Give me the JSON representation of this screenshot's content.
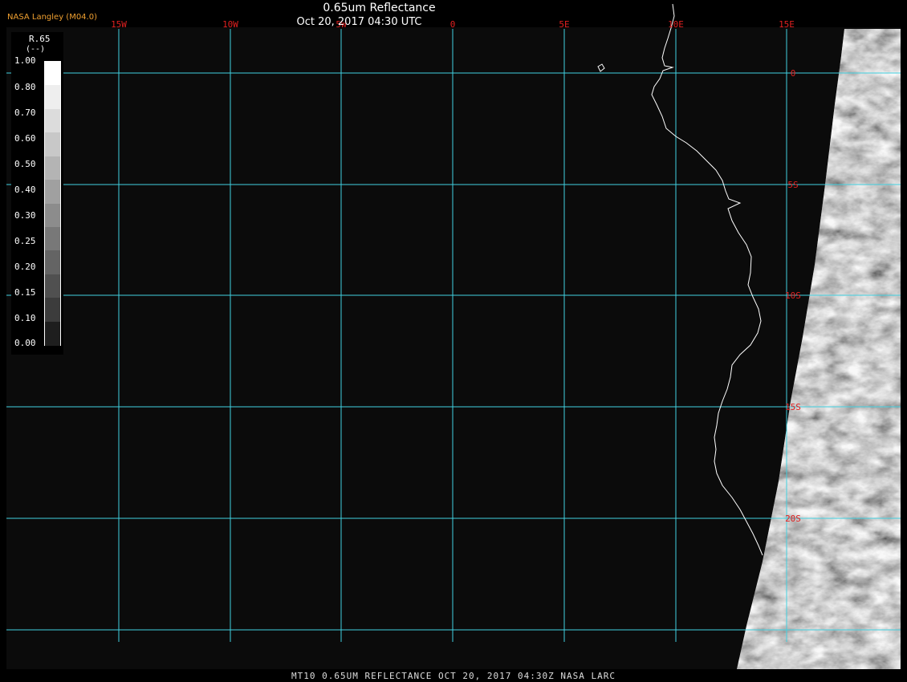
{
  "header": {
    "title": "0.65um Reflectance",
    "subtitle": "Oct 20, 2017 04:30 UTC",
    "credit": "NASA Langley (M04.0)"
  },
  "footer": {
    "text": "MT10  0.65UM REFLECTANCE   OCT 20, 2017 04:30Z   NASA LARC"
  },
  "legend": {
    "variable": "R.65",
    "unit": "(--)",
    "labels": [
      "1.00",
      "0.80",
      "0.70",
      "0.60",
      "0.50",
      "0.40",
      "0.30",
      "0.25",
      "0.20",
      "0.15",
      "0.10",
      "0.00"
    ],
    "colors": [
      "#ffffff",
      "#eeeeee",
      "#dcdcdc",
      "#c8c8c8",
      "#b4b4b4",
      "#a0a0a0",
      "#8c8c8c",
      "#787878",
      "#646464",
      "#505050",
      "#3c3c3c",
      "#1e1e1e"
    ]
  },
  "map": {
    "grid_color": "#40d0e0",
    "label_color": "#e02020",
    "coast_color": "#ffffff",
    "lon_labels": [
      "15W",
      "10W",
      "5W",
      "0",
      "5E",
      "10E",
      "15E"
    ],
    "lat_labels": [
      "0",
      "5S",
      "10S",
      "15S",
      "20S"
    ]
  }
}
